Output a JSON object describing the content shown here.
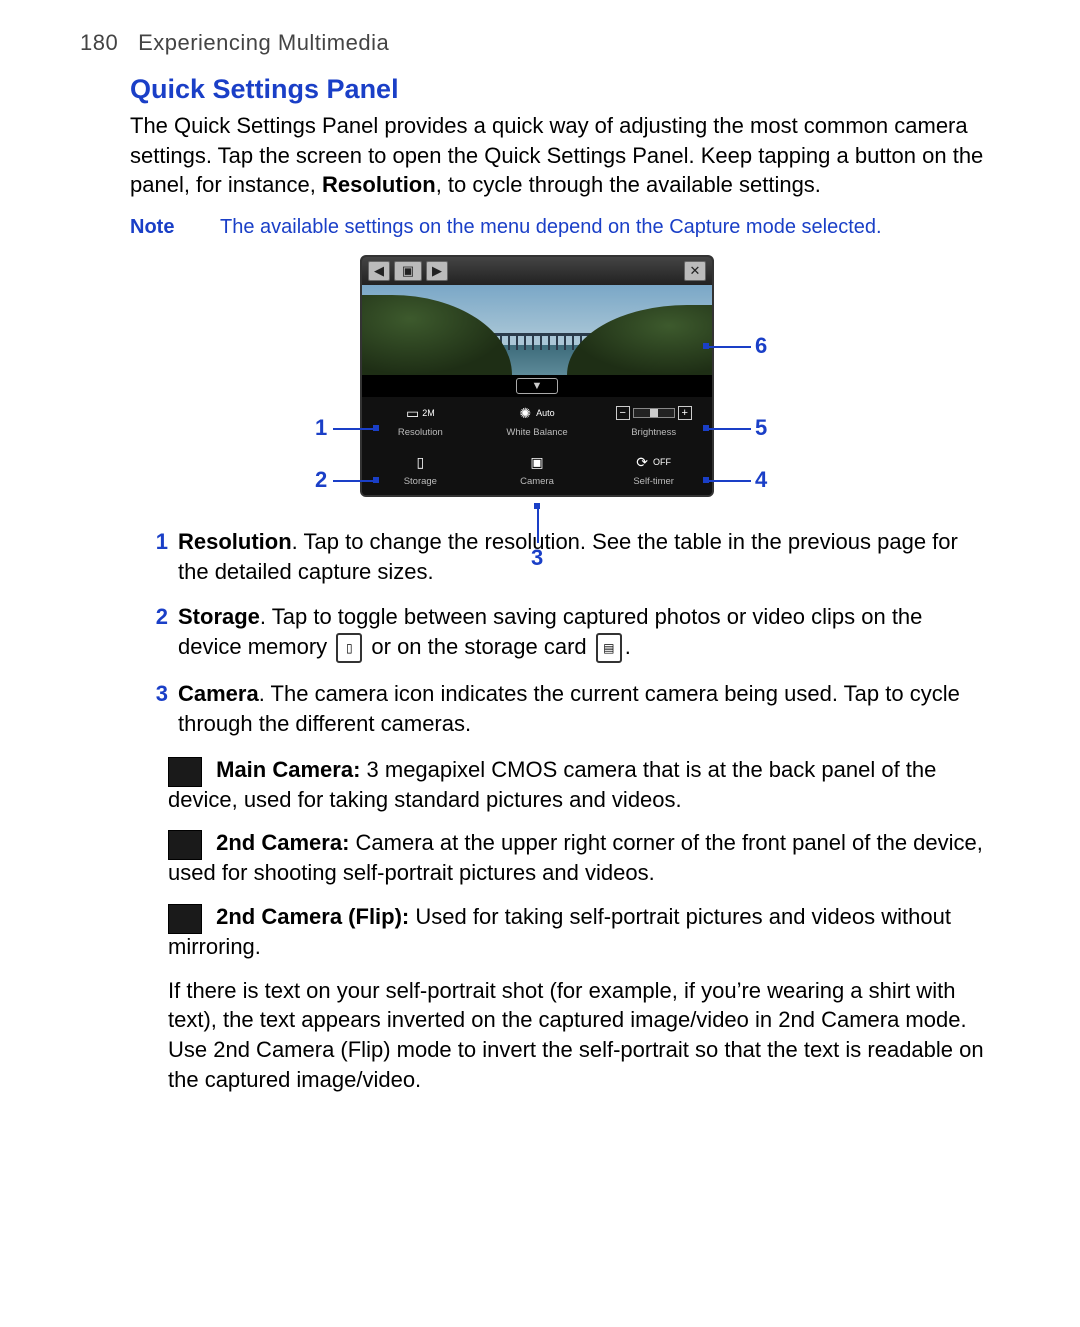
{
  "header": {
    "page_number": "180",
    "chapter": "Experiencing Multimedia"
  },
  "title": "Quick Settings Panel",
  "intro": {
    "part1": "The Quick Settings Panel provides a quick way of adjusting the most common camera settings. Tap the screen to open the Quick Settings Panel. Keep tapping a button on the panel, for instance, ",
    "bold": "Resolution",
    "part2": ", to cycle through the available settings."
  },
  "note": {
    "label": "Note",
    "text": "The available settings on the menu depend on the Capture mode selected."
  },
  "figure": {
    "close_glyph": "✕",
    "chevron": "▼",
    "cells": {
      "resolution": {
        "value": "2M",
        "label": "Resolution"
      },
      "whitebalance": {
        "value": "Auto",
        "label": "White Balance"
      },
      "brightness": {
        "minus": "−",
        "plus": "+",
        "label": "Brightness"
      },
      "storage": {
        "label": "Storage"
      },
      "camera": {
        "label": "Camera"
      },
      "selftimer": {
        "value": "OFF",
        "label": "Self-timer"
      }
    },
    "callouts": {
      "c1": "1",
      "c2": "2",
      "c3": "3",
      "c4": "4",
      "c5": "5",
      "c6": "6"
    }
  },
  "list": {
    "i1": {
      "num": "1",
      "bold": "Resolution",
      "rest": ". Tap to change the resolution. See the table in the previous page for the detailed capture sizes."
    },
    "i2": {
      "num": "2",
      "bold": "Storage",
      "rest1": ". Tap to toggle between saving captured photos or video clips on the device memory ",
      "rest2": " or on the storage card ",
      "rest3": "."
    },
    "i3": {
      "num": "3",
      "bold": "Camera",
      "rest": ". The camera icon indicates the current camera being used. Tap to cycle through the different cameras."
    }
  },
  "sub": {
    "s1": {
      "bold": "Main Camera:",
      "rest": " 3 megapixel CMOS camera that is at the back panel of the device, used for taking standard pictures and videos."
    },
    "s2": {
      "bold": "2nd Camera:",
      "rest": " Camera at the upper right corner of the front panel of the device, used for shooting self-portrait pictures and videos."
    },
    "s3": {
      "bold": "2nd Camera (Flip):",
      "rest": " Used for taking self-portrait pictures and videos without mirroring."
    },
    "s4": "If there is text on your self-portrait shot (for example, if you’re wearing a shirt with text), the text appears inverted on the captured image/video in 2nd Camera mode. Use 2nd Camera (Flip) mode to invert the self-portrait so that the text is readable on the captured image/video."
  }
}
